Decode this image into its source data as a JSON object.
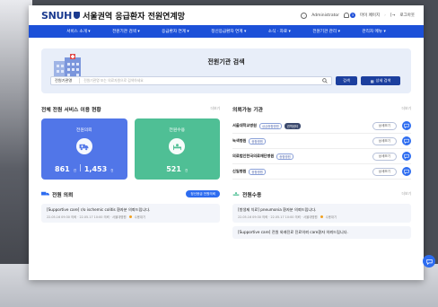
{
  "header": {
    "logo": "SNUH",
    "title": "서울권역 응급환자 전원연계망",
    "user": "Administrator",
    "badge_count": "3",
    "mypage": "마이 페이지",
    "logout": "로그아웃"
  },
  "nav": {
    "items": [
      "서비스 소개 ▾",
      "전원기관 검색 ▾",
      "응급환자 연계 ▾",
      "정신응급환자 연계 ▾",
      "소식 · 자료 ▾",
      "전원기관 관리 ▾",
      "관리자 메뉴 ▾"
    ]
  },
  "search": {
    "title": "전원기관 검색",
    "select_value": "전원기관명",
    "placeholder": "전원기관명 또는 의료자원으로 검색하세요",
    "search_label": "검색",
    "advanced_label": "상세 검색"
  },
  "stats": {
    "title": "전체 전원 서비스 이용 현황",
    "more": "더보기",
    "request": {
      "label": "전원의뢰",
      "value1": "861",
      "unit1": "건",
      "value2": "1,453",
      "unit2": "건"
    },
    "accept": {
      "label": "전원수용",
      "value": "521",
      "unit": "건"
    }
  },
  "hospitals": {
    "title": "의뢰가능 기관",
    "more": "더보기",
    "btn_label": "상세보기",
    "items": [
      {
        "name": "서울대학교병원",
        "tags": [
          "상급종합병원",
          "권역센터"
        ]
      },
      {
        "name": "녹색병원",
        "tags": [
          "종합병원"
        ]
      },
      {
        "name": "의료법인한국의료재단병원",
        "tags": [
          "종합병원"
        ]
      },
      {
        "name": "신일병원",
        "tags": [
          "종합병원"
        ]
      }
    ]
  },
  "requests": {
    "title": "전원 의뢰",
    "pill": "정신응급 전원의뢰",
    "items": [
      {
        "title": "[Supportive care] r/o ischemic colitis 환자분 의뢰드립니다.",
        "meta": "22.05.16 09:30 의뢰 · 22.05.17 10:00 의뢰 · 서울대병원",
        "status": "수용대기"
      }
    ]
  },
  "accepts": {
    "title": "전원수용",
    "more": "더보기",
    "items": [
      {
        "title": "[항생제 치료] pneumonia 환자분 의뢰드립니다.",
        "meta": "22.05.16 09:30 의뢰 · 22.05.17 10:00 의뢰 · 서울대병원",
        "status": "수용대기"
      },
      {
        "title": "[Supportive care] 전원 외래진료 진료의뢰 care환자 의뢰드립니다.",
        "meta": "",
        "status": ""
      }
    ]
  }
}
